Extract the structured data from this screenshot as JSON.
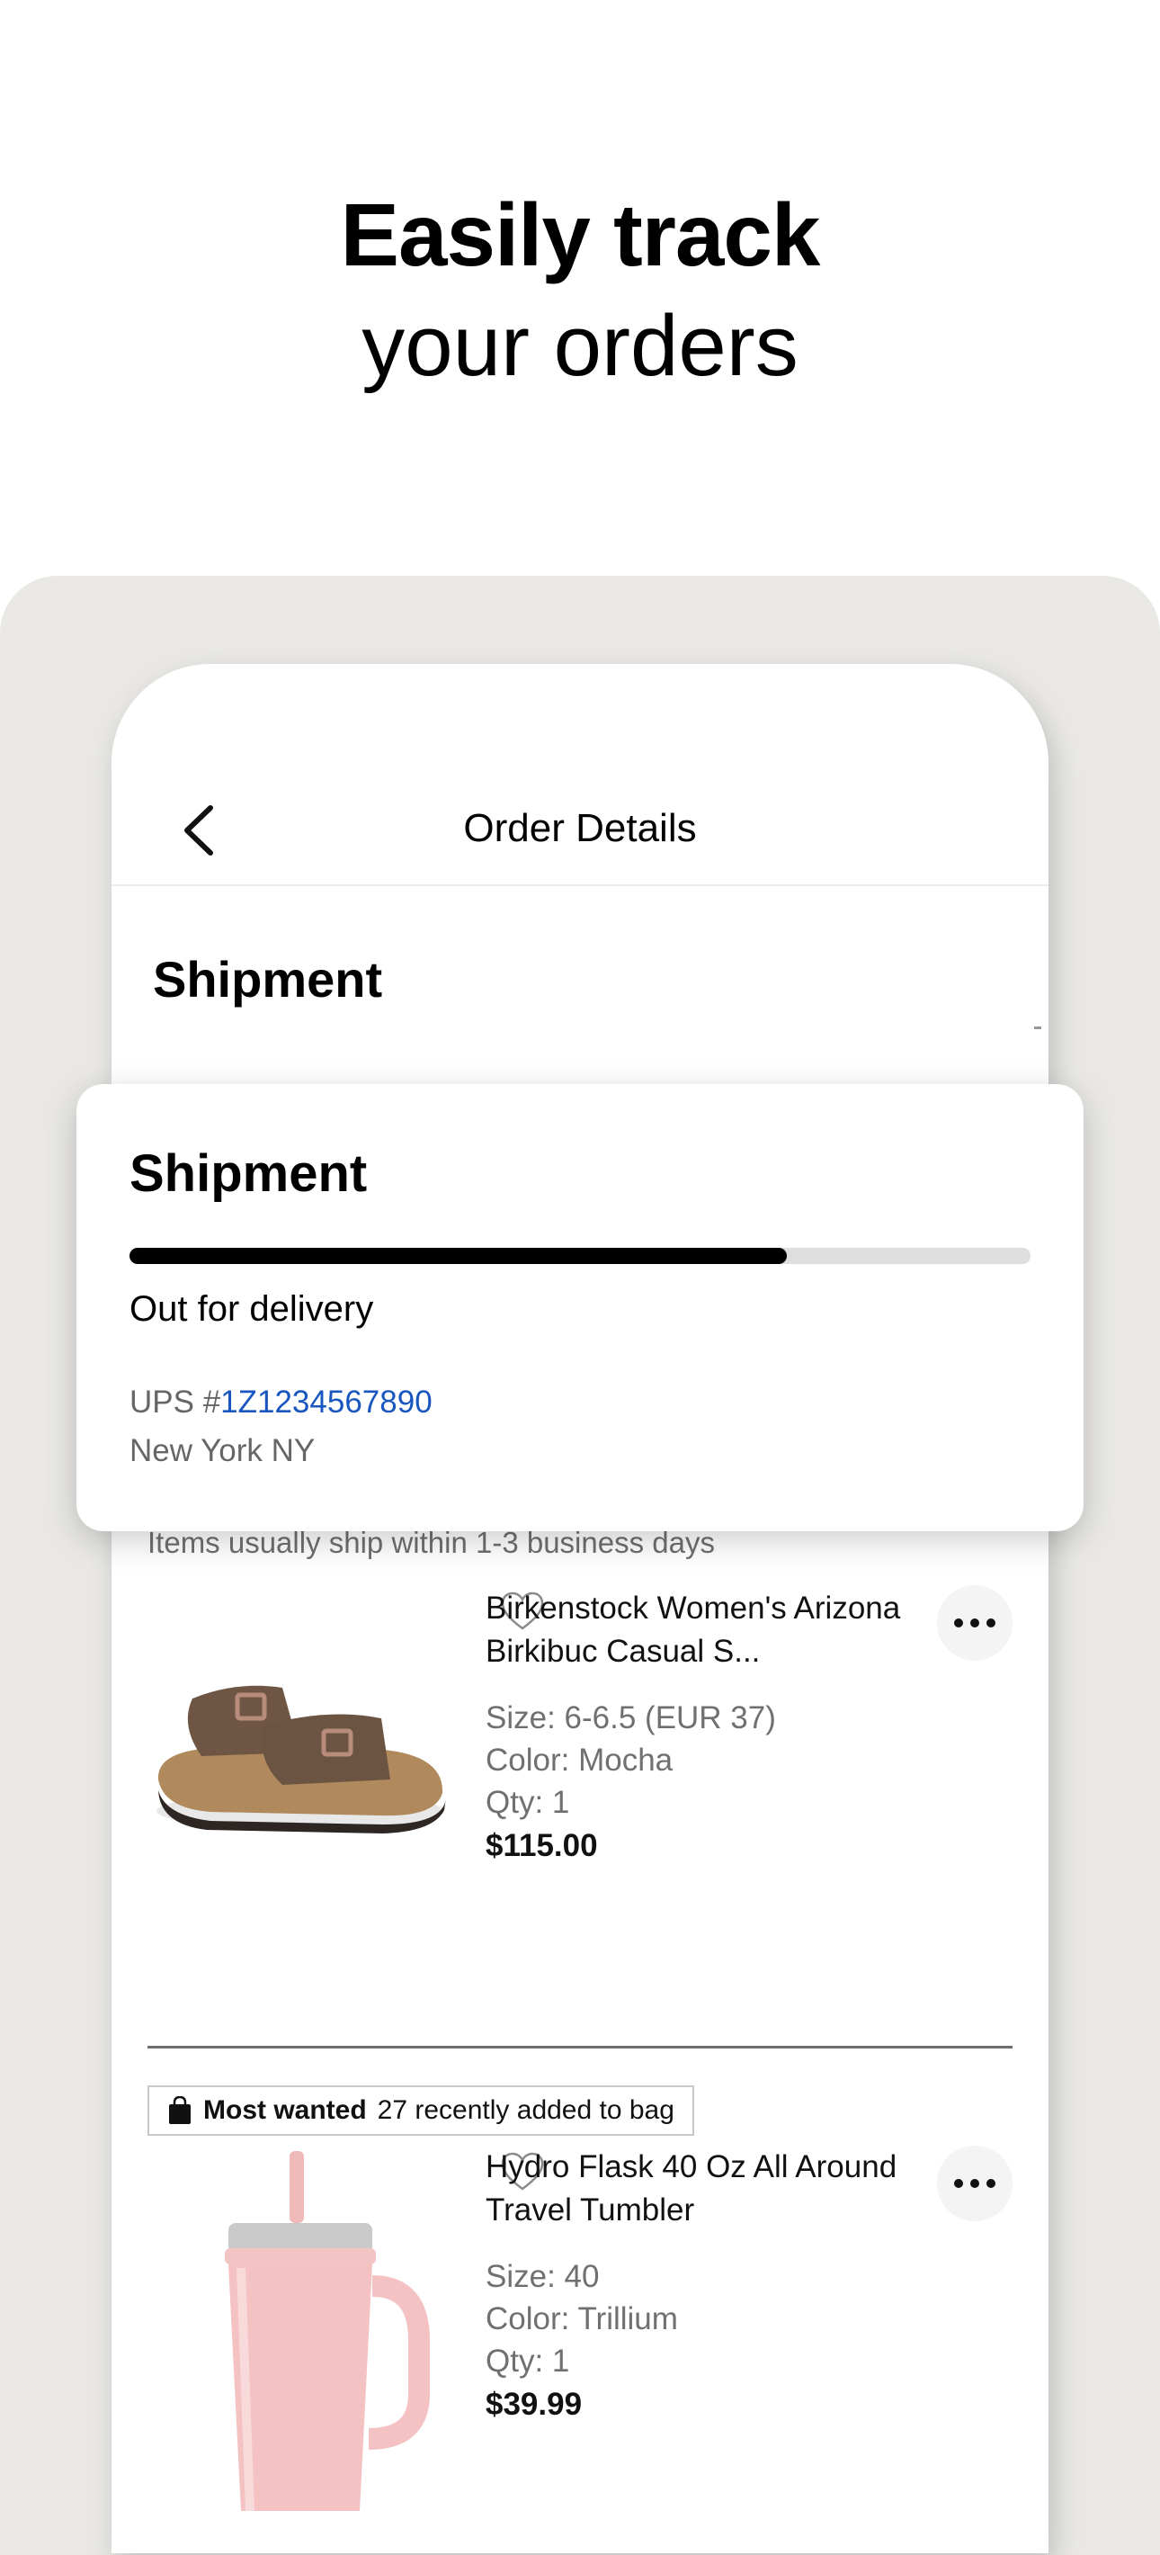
{
  "headline": {
    "bold": "Easily track",
    "regular": "your orders"
  },
  "nav": {
    "title": "Order Details",
    "back_icon": "chevron-left-icon"
  },
  "background_section_title": "Shipment",
  "shipment_card": {
    "title": "Shipment",
    "progress": 0.73,
    "status": "Out for delivery",
    "carrier_prefix": "UPS #",
    "tracking_number": "1Z1234567890",
    "location": "New York NY"
  },
  "ship_note": "Items usually ship within 1-3 business days",
  "items": [
    {
      "name": "Birkenstock Women's Arizona Birkibuc Casual S...",
      "size": "Size: 6-6.5 (EUR 37)",
      "color": "Color: Mocha",
      "qty": "Qty: 1",
      "price": "$115.00",
      "image": "sandal-image"
    },
    {
      "name": "Hydro Flask 40 Oz All Around Travel Tumbler",
      "size": "Size: 40",
      "color": "Color: Trillium",
      "qty": "Qty: 1",
      "price": "$39.99",
      "image": "tumbler-image"
    }
  ],
  "badge": {
    "label": "Most wanted",
    "text": "27 recently added to bag",
    "icon": "shopping-bag-icon"
  },
  "colors": {
    "panel_bg": "#e9e8e5",
    "link": "#1a56c0",
    "progress_fill": "#000000",
    "progress_track": "#dedede"
  }
}
